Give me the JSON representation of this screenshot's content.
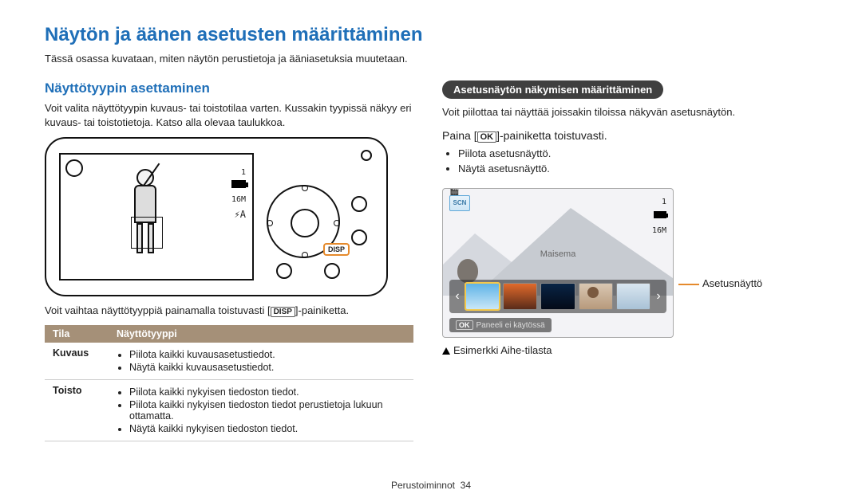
{
  "title": "Näytön ja äänen asetusten määrittäminen",
  "intro": "Tässä osassa kuvataan, miten näytön perustietoja ja ääniasetuksia muutetaan.",
  "left": {
    "heading": "Näyttötyypin asettaminen",
    "para": "Voit valita näyttötyypin kuvaus- tai toistotilaa varten. Kussakin tyypissä näkyy eri kuvaus- tai toistotietoja. Katso alla olevaa taulukkoa.",
    "lcd_res": "16M",
    "lcd_count": "1",
    "flash": "⚡A",
    "disp_chip": "DISP",
    "below_before": "Voit vaihtaa näyttötyyppiä painamalla toistuvasti [",
    "below_disp": "DISP",
    "below_after": "]-painiketta.",
    "table": {
      "headers": [
        "Tila",
        "Näyttötyyppi"
      ],
      "rows": [
        {
          "mode": "Kuvaus",
          "items": [
            "Piilota kaikki kuvausasetustiedot.",
            "Näytä kaikki kuvausasetustiedot."
          ]
        },
        {
          "mode": "Toisto",
          "items": [
            "Piilota kaikki nykyisen tiedoston tiedot.",
            "Piilota kaikki nykyisen tiedoston tiedot perustietoja lukuun ottamatta.",
            "Näytä kaikki nykyisen tiedoston tiedot."
          ]
        }
      ]
    }
  },
  "right": {
    "pill": "Asetusnäytön näkymisen määrittäminen",
    "para": "Voit piilottaa tai näyttää joissakin tiloissa näkyvän asetusnäytön.",
    "instr_before": "Paina [",
    "instr_ok": "OK",
    "instr_after": "]-painiketta toistuvasti.",
    "bullets": [
      "Piilota asetusnäyttö.",
      "Näytä asetusnäyttö."
    ],
    "preview": {
      "scn": "SCN",
      "count": "1",
      "res": "16M",
      "scene_label": "Maisema",
      "okbar_ok": "OK",
      "okbar_text": "Paneeli ei käytössä"
    },
    "callout": "Asetusnäyttö",
    "example": "Esimerkki Aihe-tilasta"
  },
  "footer": {
    "section": "Perustoiminnot",
    "page": "34"
  }
}
